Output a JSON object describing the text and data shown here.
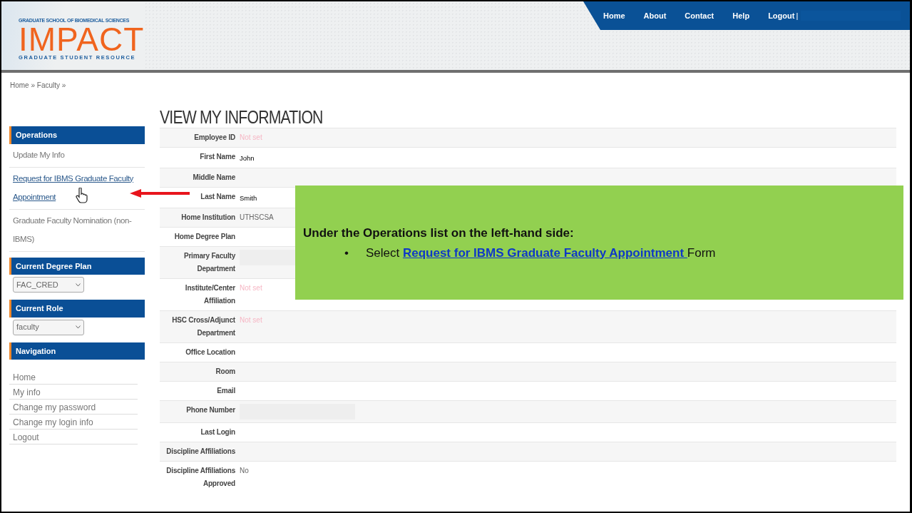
{
  "header": {
    "logo": {
      "top_line": "GRADUATE SCHOOL OF BIOMEDICAL SCIENCES",
      "name": "IMPACT",
      "bottom_line": "GRADUATE STUDENT RESOURCE"
    },
    "nav": [
      {
        "label": "Home"
      },
      {
        "label": "About"
      },
      {
        "label": "Contact"
      },
      {
        "label": "Help"
      },
      {
        "label": "Logout"
      }
    ],
    "nav_separator": "|"
  },
  "breadcrumb": "Home » Faculty »",
  "sidebar": [
    {
      "title": "Operations",
      "kind": "links",
      "items": [
        {
          "label": "Update My Info",
          "link": false
        },
        {
          "label": "Request for IBMS Graduate Faculty Appointment",
          "link": true
        },
        {
          "label": "Graduate Faculty Nomination (non-IBMS)",
          "link": false
        }
      ]
    },
    {
      "title": "Current Degree Plan",
      "kind": "select",
      "value": "FAC_CRED"
    },
    {
      "title": "Current Role",
      "kind": "select",
      "value": "faculty"
    },
    {
      "title": "Navigation",
      "kind": "list",
      "items": [
        {
          "label": "Home"
        },
        {
          "label": "My info"
        },
        {
          "label": "Change my password"
        },
        {
          "label": "Change my login info"
        },
        {
          "label": "Logout"
        }
      ]
    }
  ],
  "main": {
    "title": "VIEW MY INFORMATION",
    "rows": [
      {
        "label": "Employee ID",
        "kind": "notset",
        "value": "Not set"
      },
      {
        "label": "First Name",
        "kind": "typed",
        "value": "John"
      },
      {
        "label": "Middle Name",
        "kind": "empty"
      },
      {
        "label": "Last Name",
        "kind": "typed",
        "value": "Smith"
      },
      {
        "label": "Home Institution",
        "kind": "plain",
        "value": "UTHSCSA"
      },
      {
        "label": "Home Degree Plan",
        "kind": "empty"
      },
      {
        "label": "Primary Faculty Department",
        "kind": "hidden"
      },
      {
        "label": "Institute/Center Affiliation",
        "kind": "notset",
        "value": "Not set"
      },
      {
        "label": "HSC Cross/Adjunct Department",
        "kind": "notset",
        "value": "Not set"
      },
      {
        "label": "Office Location",
        "kind": "empty"
      },
      {
        "label": "Room",
        "kind": "empty"
      },
      {
        "label": "Email",
        "kind": "empty"
      },
      {
        "label": "Phone Number",
        "kind": "hidden"
      },
      {
        "label": "Last Login",
        "kind": "empty"
      },
      {
        "label": "Discipline Affiliations",
        "kind": "empty"
      },
      {
        "label": "Discipline Affiliations Approved",
        "kind": "plain",
        "value": "No"
      }
    ]
  },
  "callout": {
    "heading": "Under the Operations list on the left-hand side:",
    "bullet": "•",
    "prefix": "Select",
    "link": "Request for IBMS Graduate Faculty Appointment ",
    "suffix": "Form"
  }
}
